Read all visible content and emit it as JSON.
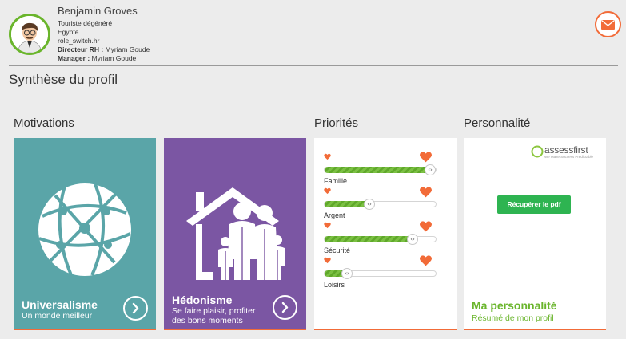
{
  "user": {
    "name": "Benjamin Groves",
    "title": "Touriste dégénéré",
    "country": "Egypte",
    "company": "role_switch.hr",
    "hr_label": "Directeur RH :",
    "hr_value": "Myriam Goude",
    "manager_label": "Manager :",
    "manager_value": "Myriam Goude"
  },
  "page_title": "Synthèse du profil",
  "sections": {
    "motivations": "Motivations",
    "priorites": "Priorités",
    "personnalite": "Personnalité"
  },
  "motivation_card": {
    "title": "Universalisme",
    "subtitle": "Un monde meilleur",
    "color": "#5aa5a8"
  },
  "hedonism_card": {
    "title": "Hédonisme",
    "subtitle_line1": "Se faire plaisir, profiter",
    "subtitle_line2": "des bons moments",
    "color": "#7b56a3"
  },
  "priorities": [
    {
      "label": "Famille",
      "value": 0.99
    },
    {
      "label": "Argent",
      "value": 0.4
    },
    {
      "label": "Sécurité",
      "value": 0.79
    },
    {
      "label": "Loisirs",
      "value": 0.2
    }
  ],
  "personality_card": {
    "logo_name": "assessfirst",
    "logo_tagline": "We Make Success Predictable",
    "pdf_button": "Récupérer le pdf",
    "title": "Ma personnalité",
    "subtitle": "Résumé de mon profil"
  },
  "colors": {
    "accent": "#f26b38",
    "green": "#6ab52c",
    "button_green": "#2eb451"
  },
  "icons": {
    "mail": "mail-icon",
    "arrow": "chevron-right-icon",
    "heart": "heart-icon",
    "globe": "globe-icon",
    "family": "family-house-icon"
  }
}
